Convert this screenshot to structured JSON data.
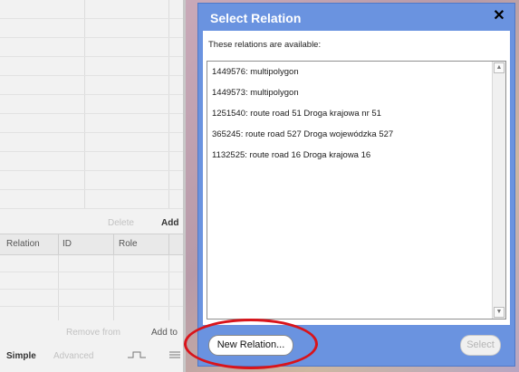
{
  "left_panel": {
    "tag_actions": {
      "delete_label": "Delete",
      "add_label": "Add"
    },
    "relations_table": {
      "columns": [
        "Relation",
        "ID",
        "Role"
      ]
    },
    "relation_actions": {
      "remove_label": "Remove from",
      "add_label": "Add to"
    },
    "modes": {
      "simple_label": "Simple",
      "advanced_label": "Advanced"
    }
  },
  "dialog": {
    "title": "Select Relation",
    "close_icon": "close-icon",
    "prompt": "These relations are available:",
    "relations": [
      "1449576: multipolygon",
      "1449573: multipolygon",
      "1251540: route road 51 Droga krajowa nr 51",
      "365245: route road 527 Droga wojewódzka 527",
      "1132525: route road 16 Droga krajowa 16"
    ],
    "new_relation_label": "New Relation...",
    "select_label": "Select"
  },
  "colors": {
    "dialog_background": "#6a93e0",
    "highlight_ring": "#d9141b",
    "disabled_text": "#b4b4b4"
  }
}
